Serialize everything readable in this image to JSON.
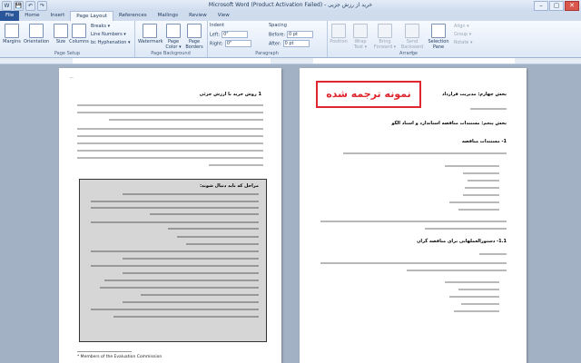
{
  "window": {
    "title": "Microsoft Word (Product Activation Failed) - خرید از رزش جزیی",
    "controls": [
      "–",
      "▢",
      "✕"
    ]
  },
  "quick_access": [
    "W",
    "💾",
    "↶",
    "↷"
  ],
  "tabs": [
    "File",
    "Home",
    "Insert",
    "Page Layout",
    "References",
    "Mailings",
    "Review",
    "View"
  ],
  "active_tab": "Page Layout",
  "ribbon": {
    "page_setup": {
      "label": "Page Setup",
      "margins": "Margins",
      "orientation": "Orientation",
      "size": "Size",
      "columns": "Columns",
      "breaks": "Breaks ▾",
      "line_numbers": "Line Numbers ▾",
      "hyphenation": "bc Hyphenation ▾"
    },
    "page_background": {
      "label": "Page Background",
      "watermark": "Watermark",
      "page_color": "Page Color ▾",
      "page_borders": "Page Borders"
    },
    "paragraph": {
      "label": "Paragraph",
      "indent": "Indent",
      "spacing": "Spacing",
      "left": "Left:",
      "right": "Right:",
      "before": "Before:",
      "after": "After:",
      "left_val": "0\"",
      "right_val": "0\"",
      "before_val": "0 pt",
      "after_val": "0 pt"
    },
    "arrange": {
      "label": "Arrange",
      "position": "Position",
      "wrap_text": "Wrap Text ▾",
      "bring_forward": "Bring Forward ▾",
      "send_backward": "Send Backward ▾",
      "selection_pane": "Selection Pane",
      "align": "Align ▾",
      "group": "Group ▾",
      "rotate": "Rotate ▾"
    }
  },
  "left_page": {
    "heading": "1 روش خرید با ارزش جزئی",
    "box_title": "مراحل که باید دنبال شوند:",
    "footnote": "* Members of the Evaluation Commission"
  },
  "right_page": {
    "stamp": "نمونه ترجمه شده",
    "heading1": "بخش چهارم: مدیریت قرارداد",
    "heading2": "بخش پنجم: مستندات مناقصه استاندارد و اسناد الگو",
    "sub1": "1- مستندات مناقصه",
    "sub2": "1.1- دستورالعملهایی برای مناقصه گران"
  }
}
